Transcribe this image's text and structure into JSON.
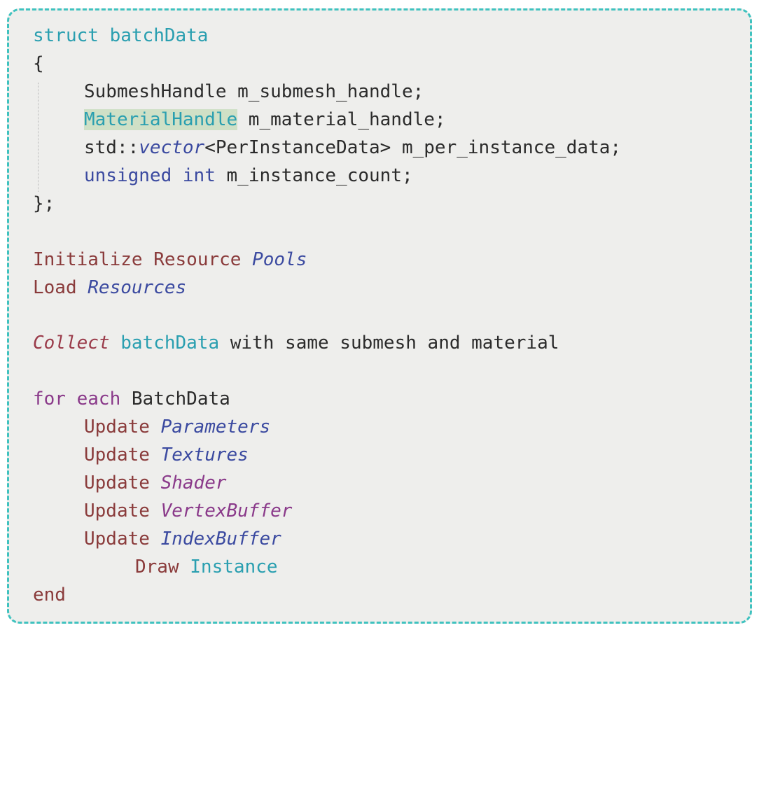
{
  "lines": {
    "l1": {
      "a": "struct",
      "b": " batchData"
    },
    "l2": {
      "a": "{"
    },
    "l3": {
      "a": "SubmeshHandle",
      "b": " m_submesh_handle;"
    },
    "l4": {
      "a": "MaterialHandle",
      "b": " m_material_handle;"
    },
    "l5": {
      "a": "std::",
      "b": "vector",
      "c": "<PerInstanceData> m_per_instance_data;"
    },
    "l6": {
      "a": "unsigned",
      "b": " int",
      "c": " m_instance_count;"
    },
    "l7": {
      "a": "};"
    },
    "l8": {
      "a": "Initialize",
      "b": " Resource",
      "c": " Pools"
    },
    "l9": {
      "a": "Load",
      "b": " Resources"
    },
    "l10": {
      "a": "Collect",
      "b": " batchData",
      "c": " with same submesh and material"
    },
    "l11": {
      "a": "for",
      "b": " each",
      "c": " BatchData"
    },
    "l12": {
      "a": "Update",
      "b": " Parameters"
    },
    "l13": {
      "a": "Update",
      "b": " Textures"
    },
    "l14": {
      "a": "Update",
      "b": " Shader"
    },
    "l15": {
      "a": "Update",
      "b": " VertexBuffer"
    },
    "l16": {
      "a": "Update",
      "b": " IndexBuffer"
    },
    "l17": {
      "a": "Draw",
      "b": " Instance"
    },
    "l18": {
      "a": "end"
    }
  }
}
